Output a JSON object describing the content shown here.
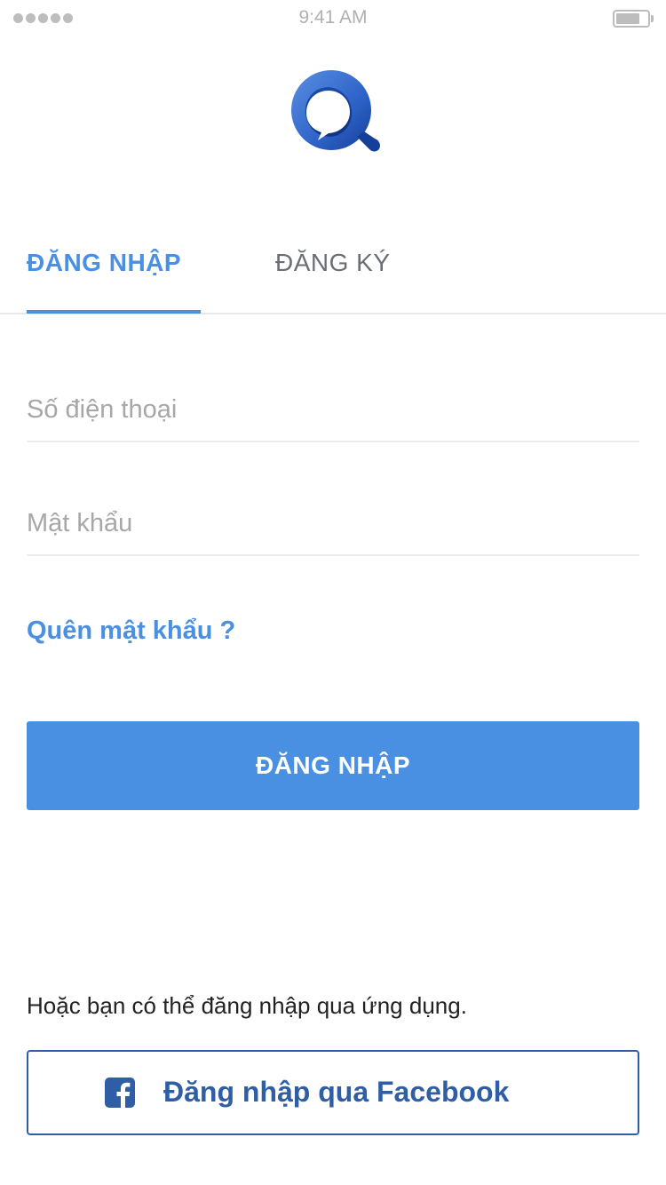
{
  "status_bar": {
    "time": "9:41 AM"
  },
  "tabs": {
    "login": "ĐĂNG NHẬP",
    "register": "ĐĂNG KÝ"
  },
  "form": {
    "phone_placeholder": "Số điện thoại",
    "password_placeholder": "Mật khẩu",
    "forgot_password": "Quên mật khẩu ?",
    "submit_label": "ĐĂNG NHẬP"
  },
  "alternative": {
    "text": "Hoặc bạn có thể đăng nhập qua ứng dụng.",
    "facebook_label": "Đăng nhập qua Facebook",
    "facebook_icon": "facebook-icon"
  },
  "colors": {
    "accent": "#4a90e2",
    "facebook": "#2f5ea6"
  }
}
